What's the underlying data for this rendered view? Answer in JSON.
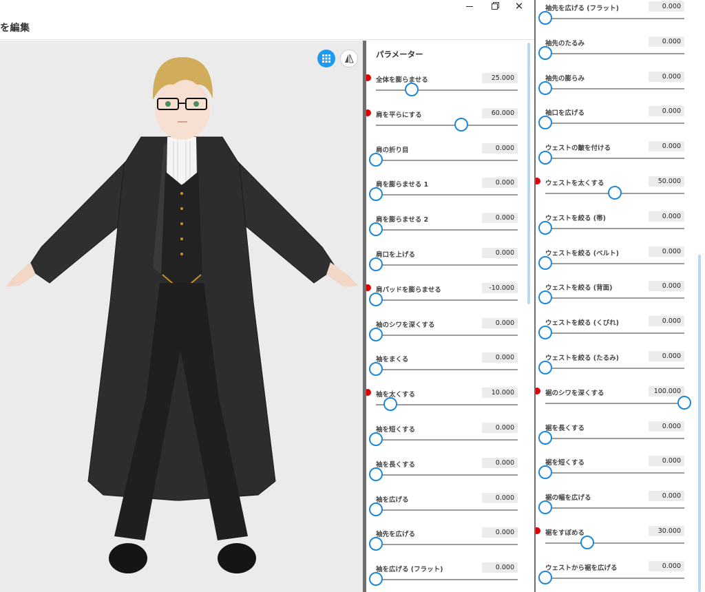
{
  "window": {
    "title": "を編集",
    "close_glyph": "✕"
  },
  "toolbar": {
    "grid_icon": "grid-icon",
    "mirror_icon": "mirror-icon"
  },
  "colors": {
    "accent": "#1e88d8",
    "modified": "#e00000",
    "viewport": "#ebebeb"
  },
  "panel": {
    "heading": "パラメーター"
  },
  "params_left": [
    {
      "label": "全体を膨らませる",
      "value": "25.000",
      "level": 25,
      "modified": true
    },
    {
      "label": "肩を平らにする",
      "value": "60.000",
      "level": 60,
      "modified": true
    },
    {
      "label": "肩の折り目",
      "value": "0.000",
      "level": 0,
      "modified": false
    },
    {
      "label": "肩を膨らませる 1",
      "value": "0.000",
      "level": 0,
      "modified": false
    },
    {
      "label": "肩を膨らませる 2",
      "value": "0.000",
      "level": 0,
      "modified": false
    },
    {
      "label": "肩口を上げる",
      "value": "0.000",
      "level": 0,
      "modified": false
    },
    {
      "label": "肩パッドを膨らませる",
      "value": "-10.000",
      "level": 0,
      "modified": true
    },
    {
      "label": "袖のシワを深くする",
      "value": "0.000",
      "level": 0,
      "modified": false
    },
    {
      "label": "袖をまくる",
      "value": "0.000",
      "level": 0,
      "modified": false
    },
    {
      "label": "袖を太くする",
      "value": "10.000",
      "level": 10,
      "modified": true
    },
    {
      "label": "袖を短くする",
      "value": "0.000",
      "level": 0,
      "modified": false
    },
    {
      "label": "袖を長くする",
      "value": "0.000",
      "level": 0,
      "modified": false
    },
    {
      "label": "袖を広げる",
      "value": "0.000",
      "level": 0,
      "modified": false
    },
    {
      "label": "袖先を広げる",
      "value": "0.000",
      "level": 0,
      "modified": false
    },
    {
      "label": "袖を広げる (フラット)",
      "value": "0.000",
      "level": 0,
      "modified": false
    }
  ],
  "params_right": [
    {
      "label": "袖先を広げる (フラット)",
      "value": "0.000",
      "level": 0,
      "modified": false
    },
    {
      "label": "袖先のたるみ",
      "value": "0.000",
      "level": 0,
      "modified": false
    },
    {
      "label": "袖先の膨らみ",
      "value": "0.000",
      "level": 0,
      "modified": false
    },
    {
      "label": "袖口を広げる",
      "value": "0.000",
      "level": 0,
      "modified": false
    },
    {
      "label": "ウェストの皺を付ける",
      "value": "0.000",
      "level": 0,
      "modified": false
    },
    {
      "label": "ウェストを太くする",
      "value": "50.000",
      "level": 50,
      "modified": true
    },
    {
      "label": "ウェストを絞る (帯)",
      "value": "0.000",
      "level": 0,
      "modified": false
    },
    {
      "label": "ウェストを絞る (ベルト)",
      "value": "0.000",
      "level": 0,
      "modified": false
    },
    {
      "label": "ウェストを絞る (背面)",
      "value": "0.000",
      "level": 0,
      "modified": false
    },
    {
      "label": "ウェストを絞る (くびれ)",
      "value": "0.000",
      "level": 0,
      "modified": false
    },
    {
      "label": "ウェストを絞る (たるみ)",
      "value": "0.000",
      "level": 0,
      "modified": false
    },
    {
      "label": "裾のシワを深くする",
      "value": "100.000",
      "level": 100,
      "modified": true
    },
    {
      "label": "裾を長くする",
      "value": "0.000",
      "level": 0,
      "modified": false
    },
    {
      "label": "裾を短くする",
      "value": "0.000",
      "level": 0,
      "modified": false
    },
    {
      "label": "裾の幅を広げる",
      "value": "0.000",
      "level": 0,
      "modified": false
    },
    {
      "label": "裾をすぼめる",
      "value": "30.000",
      "level": 30,
      "modified": true
    },
    {
      "label": "ウェストから裾を広げる",
      "value": "0.000",
      "level": 0,
      "modified": false
    }
  ]
}
